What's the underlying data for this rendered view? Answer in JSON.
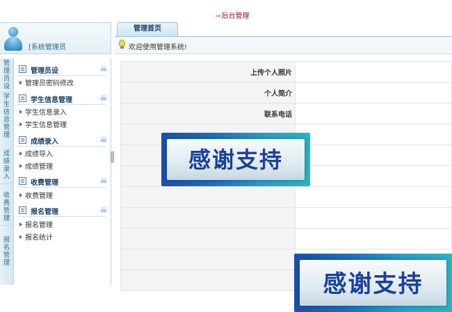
{
  "header": {
    "back_link": "后台管理",
    "back_arrow": "⇨"
  },
  "user": {
    "role_label": "[系统管理员"
  },
  "left_tabs": [
    "管理员设",
    "学生信息管理",
    "成绩录入",
    "收费管理",
    "报名管理"
  ],
  "menu": {
    "sections": [
      {
        "title": "管理员设",
        "items": [
          "管理员密码修改"
        ]
      },
      {
        "title": "学生信息管理",
        "items": [
          "学生信息录入",
          "学生信息管理"
        ]
      },
      {
        "title": "成绩录入",
        "items": [
          "成绩导入",
          "成绩管理"
        ]
      },
      {
        "title": "收费管理",
        "items": [
          "收费管理"
        ]
      },
      {
        "title": "报名管理",
        "items": [
          "报名管理",
          "报名统计"
        ]
      }
    ]
  },
  "tabs": [
    {
      "label": "管理首页"
    }
  ],
  "welcome": "欢迎使用管理系统!",
  "form": {
    "rows": [
      {
        "label": "上传个人照片",
        "value": ""
      },
      {
        "label": "个人简介",
        "value": ""
      },
      {
        "label": "联系电话",
        "value": ""
      },
      {
        "label": "",
        "value": ""
      },
      {
        "label": "",
        "value": ""
      },
      {
        "label": "",
        "value": ""
      },
      {
        "label": "",
        "value": ""
      },
      {
        "label": "",
        "value": ""
      },
      {
        "label": "",
        "value": ""
      },
      {
        "label": "",
        "value": ""
      },
      {
        "label": "",
        "value": ""
      }
    ]
  },
  "watermark": {
    "text": "感谢支持"
  },
  "colors": {
    "accent": "#2d6f99",
    "header_link": "#8b1a1a",
    "banner_text": "#1b3f9c"
  },
  "icons": {
    "section_icon": "edit-icon",
    "collapse_icon": "double-chevron-up-icon",
    "welcome_icon": "lightbulb-icon",
    "user_icon": "user-avatar-icon"
  }
}
